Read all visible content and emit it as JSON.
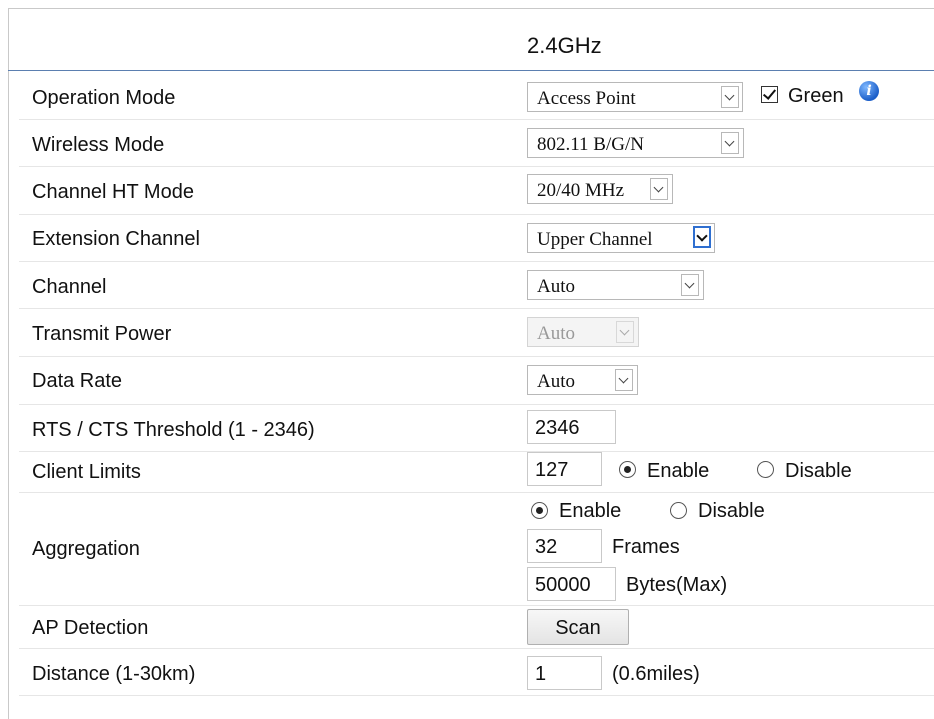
{
  "header": {
    "band": "2.4GHz"
  },
  "rows": {
    "operation_mode": {
      "label": "Operation Mode",
      "value": "Access Point",
      "green_label": "Green",
      "green_checked": true,
      "info_icon": "info-icon"
    },
    "wireless_mode": {
      "label": "Wireless Mode",
      "value": "802.11 B/G/N"
    },
    "channel_ht_mode": {
      "label": "Channel HT Mode",
      "value": "20/40 MHz"
    },
    "extension_channel": {
      "label": "Extension Channel",
      "value": "Upper Channel"
    },
    "channel": {
      "label": "Channel",
      "value": "Auto"
    },
    "transmit_power": {
      "label": "Transmit Power",
      "value": "Auto",
      "disabled": true
    },
    "data_rate": {
      "label": "Data Rate",
      "value": "Auto"
    },
    "rts_cts": {
      "label": "RTS / CTS Threshold (1 - 2346)",
      "value": "2346"
    },
    "client_limits": {
      "label": "Client Limits",
      "value": "127",
      "enable_label": "Enable",
      "disable_label": "Disable",
      "selected": "Enable"
    },
    "aggregation": {
      "label": "Aggregation",
      "enable_label": "Enable",
      "disable_label": "Disable",
      "selected": "Enable",
      "frames_value": "32",
      "frames_label": "Frames",
      "bytes_value": "50000",
      "bytes_label": "Bytes(Max)"
    },
    "ap_detection": {
      "label": "AP Detection",
      "button": "Scan"
    },
    "distance": {
      "label": "Distance (1-30km)",
      "value": "1",
      "note": "(0.6miles)"
    }
  },
  "colors": {
    "header_rule": "#5b7fb0",
    "focus_blue": "#2f6fd0",
    "info_blue": "#1c5fc9"
  }
}
